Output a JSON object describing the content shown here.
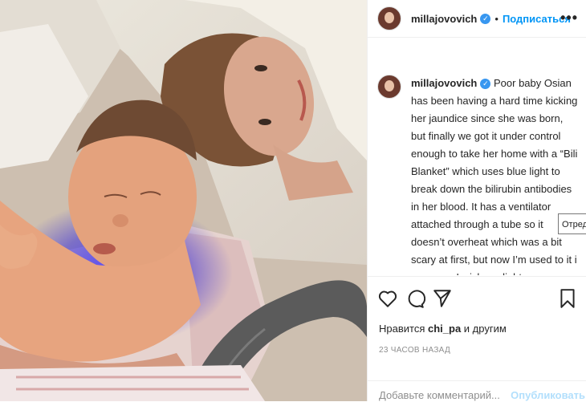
{
  "post": {
    "username": "millajovovich",
    "verified_mark": "✓",
    "dot": "•",
    "follow_label": "Подписаться",
    "more_label": "•••",
    "caption": "Poor baby Osian has been having a hard time kicking her jaundice since she was born, but finally we got it under control enough to take her home with a “Bili Blanket” which uses blue light to break down the bilirubin antibodies in her blood. It has a ventilator attached through a tube so it doesn’t overheat which was a bit scary at first, but now I’m used to it i suppose. I wish sunlight was",
    "tooltip": "Отредактировано",
    "likes_prefix": "Нравится ",
    "likes_user": "chi_pa",
    "likes_suffix": " и другим",
    "timestamp": "23 ЧАСОВ НАЗАД",
    "comment_placeholder": "Добавьте комментарий...",
    "publish_label": "Опубликовать"
  },
  "icons": {
    "like": "heart-icon",
    "comment": "comment-icon",
    "share": "share-icon",
    "save": "bookmark-icon"
  },
  "colors": {
    "accent": "#0095f6",
    "verified": "#3897f0",
    "text": "#262626",
    "muted": "#8e8e8e",
    "publish_disabled": "#b2dffc"
  }
}
